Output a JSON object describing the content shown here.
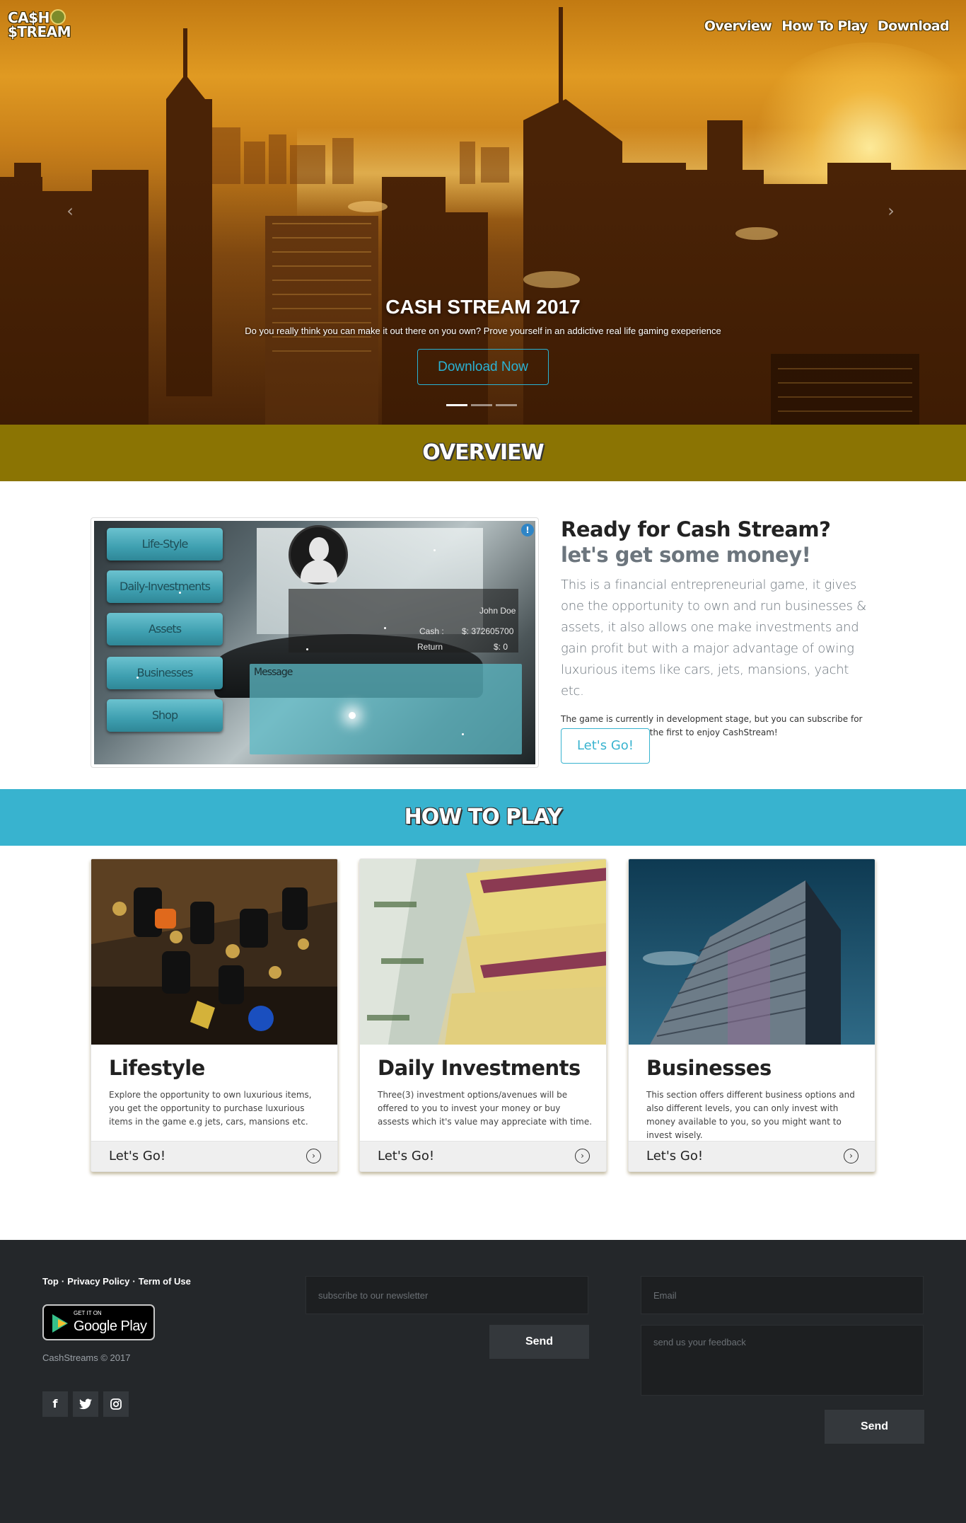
{
  "brand": {
    "logo_line1": "CA$H",
    "logo_line2": "$TREAM"
  },
  "nav": {
    "items": [
      "Overview",
      "How To Play",
      "Download"
    ]
  },
  "hero": {
    "title": "CASH STREAM 2017",
    "subtitle": "Do you really think you can make it out there on you own? Prove yourself in an addictive real life gaming exeperience",
    "button": "Download Now",
    "slides": 3,
    "active_slide": 1
  },
  "overview": {
    "band_title": "OVERVIEW",
    "heading": "Ready for Cash Stream?",
    "heading_muted": "let's get some money!",
    "lead": "This is a financial entrepreneurial game, it gives one the opportunity to own and run businesses & assets, it also allows one make investments and gain profit but with a major advantage of owing luxurious items like cars, jets, mansions, yacht etc.",
    "note": "The game is currently in development stage, but you can subscribe for our newsletter to be the first to enjoy CashStream!",
    "button": "Let's Go!",
    "screenshot": {
      "menu": [
        "Life-Style",
        "Daily-Investments",
        "Assets",
        "Businesses",
        "Shop"
      ],
      "player_name": "John Doe",
      "cash_label": "Cash :",
      "cash_value": "$: 372605700",
      "return_label": "Return",
      "return_value": "$: 0",
      "message_label": "Message",
      "badge": "!"
    }
  },
  "howto": {
    "band_title": "HOW TO PLAY",
    "cards": [
      {
        "title": "Lifestyle",
        "text": "Explore the opportunity to own luxurious items, you get the opportunity to purchase luxurious items in the game e.g jets, cars, mansions etc.",
        "footer": "Let's Go!",
        "image": "car-keys-photo"
      },
      {
        "title": "Daily Investments",
        "text": "Three(3) investment options/avenues will be offered to you to invest your money or buy assests which it's value may appreciate with time.",
        "footer": "Let's Go!",
        "image": "savings-bonds-photo"
      },
      {
        "title": "Businesses",
        "text": "This section offers different business options and also different levels, you can only invest with money available to you, so you might want to invest wisely.",
        "footer": "Let's Go!",
        "image": "office-building-photo"
      }
    ]
  },
  "footer": {
    "links": [
      "Top",
      "Privacy Policy",
      "Term of Use"
    ],
    "link_sep": "·",
    "gplay_small": "GET IT ON",
    "gplay_big": "Google Play",
    "copyright": "CashStreams © 2017",
    "social": [
      "facebook-icon",
      "twitter-icon",
      "instagram-icon"
    ],
    "newsletter_placeholder": "subscribe to our newsletter",
    "newsletter_button": "Send",
    "email_placeholder": "Email",
    "feedback_placeholder": "send us your feedback",
    "feedback_button": "Send"
  }
}
